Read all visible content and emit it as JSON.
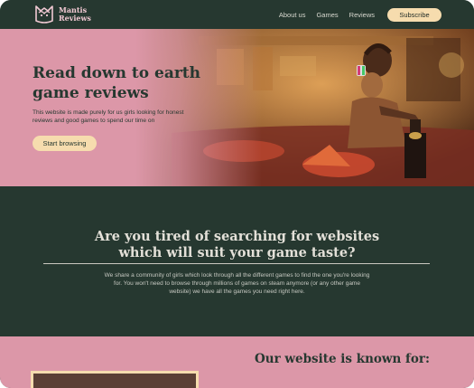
{
  "nav": {
    "logo_line1": "Mantis",
    "logo_line2": "Reviews",
    "links": [
      "About us",
      "Games",
      "Reviews"
    ],
    "subscribe_label": "Subscribe"
  },
  "hero": {
    "title": "Read down to earth game reviews",
    "subtitle": "This website is made purely for us girls looking for honest reviews and good games to spend our time on",
    "cta_label": "Start browsing"
  },
  "intro": {
    "title": "Are you tired of searching for websites which will suit your game taste?",
    "body": "We share a community of girls which look through all the different games to find the one you're looking for. You won't need to browse through millions of games on steam anymore (or any other game website) we have all the games you need right here."
  },
  "known": {
    "title": "Our website is known for:"
  },
  "colors": {
    "dark_green": "#263830",
    "pink": "#dc97a8",
    "cream": "#f6dcae"
  }
}
